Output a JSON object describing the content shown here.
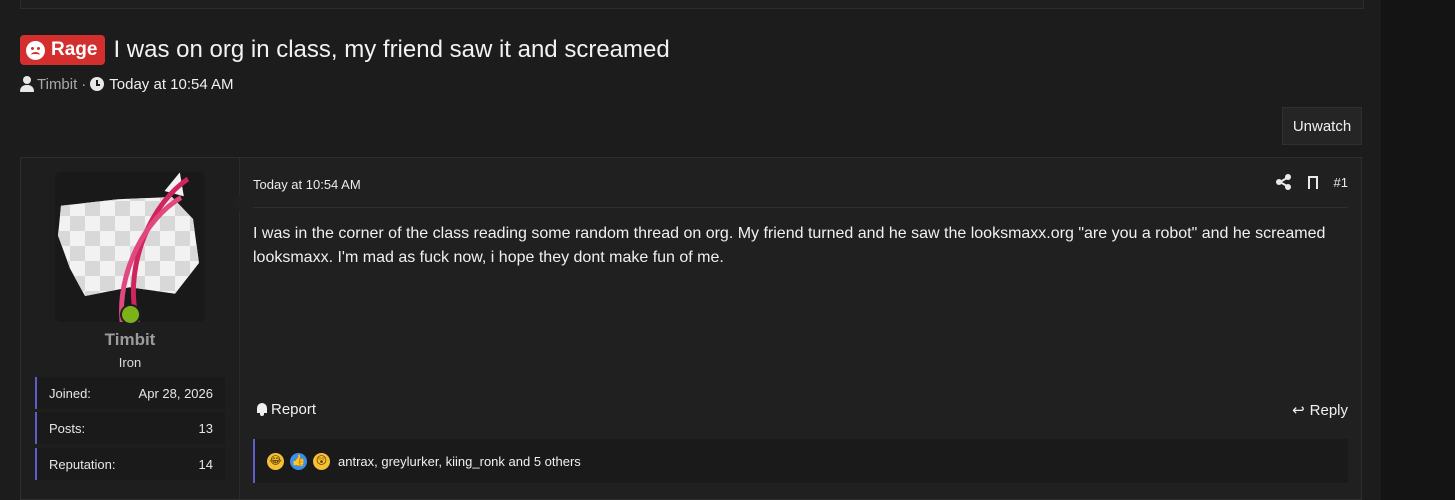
{
  "thread": {
    "prefix": "Rage",
    "title": "I was on org in class, my friend saw it and screamed",
    "author": "Timbit",
    "separator": "·",
    "date": "Today at 10:54 AM"
  },
  "actions": {
    "unwatch_label": "Unwatch"
  },
  "post": {
    "user": {
      "name": "Timbit",
      "title": "Iron",
      "online": true,
      "stats": [
        {
          "label": "Joined:",
          "value": "Apr 28, 2026"
        },
        {
          "label": "Posts:",
          "value": "13"
        },
        {
          "label": "Reputation:",
          "value": "14"
        }
      ]
    },
    "date": "Today at 10:54 AM",
    "number": "#1",
    "body": "I was in the corner of the class reading some random thread on org. My friend turned and he saw the looksmaxx.org \"are you a robot\" and he screamed looksmaxx. I'm mad as fuck now, i hope they dont make fun of me.",
    "report_label": "Report",
    "reply_label": "Reply",
    "reactions": {
      "icons": [
        "laugh-reaction-icon",
        "like-reaction-icon",
        "wow-reaction-icon"
      ],
      "users_text": "antrax, greylurker, kiing_ronk and 5 others"
    }
  },
  "colors": {
    "prefix_bg": "#d32f2f",
    "accent_bar": "#5b5fc7",
    "online": "#7cb31a"
  }
}
